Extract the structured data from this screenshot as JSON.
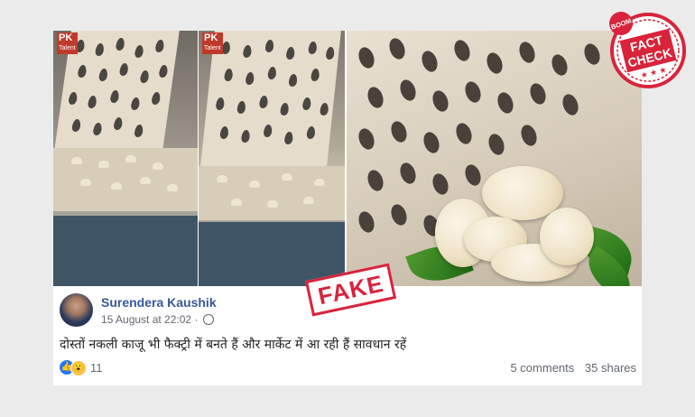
{
  "images": {
    "watermark": {
      "brand": "PK",
      "sub": "Talent"
    },
    "stamp_text": "FAKE"
  },
  "badge": {
    "top": "BOOM",
    "line1": "FACT",
    "line2": "CHECK",
    "color": "#d9233b"
  },
  "post": {
    "author": "Surendera Kaushik",
    "timestamp": "15 August at 22:02",
    "privacy_icon": "globe-icon",
    "text": "दोस्तों नकली काजू भी फैक्ट्री में बनते हैं और मार्केट में आ रही हैं सावधान रहें",
    "reaction_count": "11",
    "comments": "5 comments",
    "shares": "35 shares",
    "reaction_icons": [
      "like-icon",
      "wow-icon"
    ]
  },
  "colors": {
    "author": "#365899",
    "meta": "#606770",
    "like": "#2078f4",
    "wow": "#f7c44a",
    "stamp": "#d9233b"
  }
}
